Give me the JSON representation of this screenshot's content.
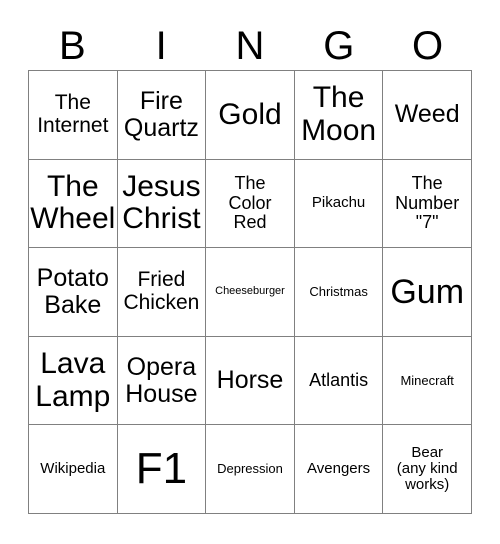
{
  "card": {
    "header": {
      "letters": [
        "B",
        "I",
        "N",
        "G",
        "O"
      ]
    },
    "rows": [
      [
        {
          "text": "The\nInternet",
          "size": "m"
        },
        {
          "text": "Fire\nQuartz",
          "size": "l"
        },
        {
          "text": "Gold",
          "size": "xl"
        },
        {
          "text": "The\nMoon",
          "size": "xl"
        },
        {
          "text": "Weed",
          "size": "l"
        }
      ],
      [
        {
          "text": "The\nWheel",
          "size": "xl"
        },
        {
          "text": "Jesus\nChrist",
          "size": "xl"
        },
        {
          "text": "The\nColor\nRed",
          "size": "s"
        },
        {
          "text": "Pikachu",
          "size": "xs"
        },
        {
          "text": "The\nNumber\n\"7\"",
          "size": "s"
        }
      ],
      [
        {
          "text": "Potato\nBake",
          "size": "l"
        },
        {
          "text": "Fried\nChicken",
          "size": "m"
        },
        {
          "text": "Cheeseburger",
          "size": "tiny"
        },
        {
          "text": "Christmas",
          "size": "xxs"
        },
        {
          "text": "Gum",
          "size": "xxl"
        }
      ],
      [
        {
          "text": "Lava\nLamp",
          "size": "xl"
        },
        {
          "text": "Opera\nHouse",
          "size": "l"
        },
        {
          "text": "Horse",
          "size": "l"
        },
        {
          "text": "Atlantis",
          "size": "s"
        },
        {
          "text": "Minecraft",
          "size": "xxs"
        }
      ],
      [
        {
          "text": "Wikipedia",
          "size": "xs"
        },
        {
          "text": "F1",
          "size": "f1"
        },
        {
          "text": "Depression",
          "size": "xxs"
        },
        {
          "text": "Avengers",
          "size": "xs"
        },
        {
          "text": "Bear\n(any kind\nworks)",
          "size": "xs"
        }
      ]
    ]
  },
  "colors": {
    "border": "#808080",
    "text": "#000000",
    "background": "#ffffff"
  }
}
